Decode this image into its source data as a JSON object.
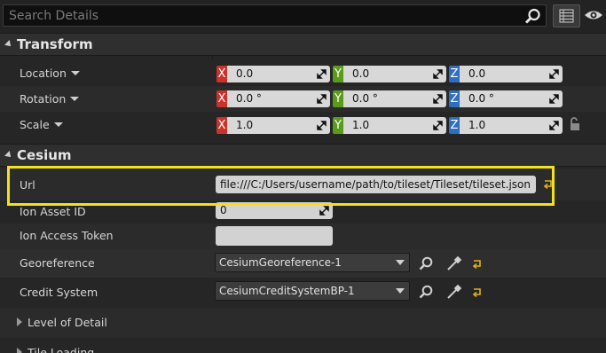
{
  "search": {
    "placeholder": "Search Details"
  },
  "sections": {
    "transform": "Transform",
    "cesium": "Cesium"
  },
  "transform": {
    "location": {
      "label": "Location",
      "x": "0.0",
      "y": "0.0",
      "z": "0.0"
    },
    "rotation": {
      "label": "Rotation",
      "x": "0.0 °",
      "y": "0.0 °",
      "z": "0.0 °"
    },
    "scale": {
      "label": "Scale",
      "x": "1.0",
      "y": "1.0",
      "z": "1.0"
    }
  },
  "axes": {
    "x": "X",
    "y": "Y",
    "z": "Z"
  },
  "cesium": {
    "url": {
      "label": "Url",
      "value": "file:///C:/Users/username/path/to/tileset/Tileset/tileset.json"
    },
    "ion_asset_id": {
      "label": "Ion Asset ID",
      "value": "0"
    },
    "ion_access_token": {
      "label": "Ion Access Token",
      "value": ""
    },
    "georeference": {
      "label": "Georeference",
      "value": "CesiumGeoreference-1"
    },
    "credit_system": {
      "label": "Credit System",
      "value": "CesiumCreditSystemBP-1"
    },
    "level_of_detail": "Level of Detail",
    "tile_loading": "Tile Loading"
  },
  "colors": {
    "highlight": "#f2e21b",
    "axis_x": "#c9332b",
    "axis_y": "#5a9b1a",
    "axis_z": "#2f6fbf",
    "reset": "#e0b21a"
  }
}
